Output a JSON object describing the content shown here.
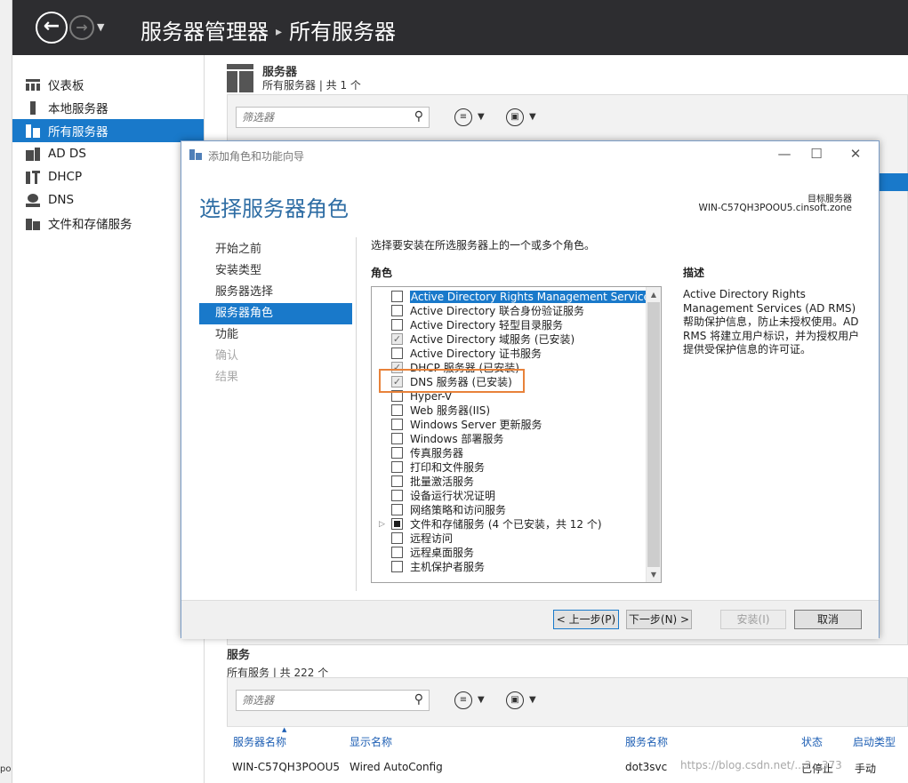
{
  "app": {
    "title": "服务器管理器",
    "breadcrumb_sep": "▸",
    "breadcrumb_current": "所有服务器"
  },
  "sidebar": {
    "items": [
      {
        "label": "仪表板",
        "icon": "dashboard-icon"
      },
      {
        "label": "本地服务器",
        "icon": "local-server-icon"
      },
      {
        "label": "所有服务器",
        "icon": "all-servers-icon",
        "active": true
      },
      {
        "label": "AD DS",
        "icon": "ad-ds-icon"
      },
      {
        "label": "DHCP",
        "icon": "dhcp-icon"
      },
      {
        "label": "DNS",
        "icon": "dns-icon"
      },
      {
        "label": "文件和存储服务",
        "icon": "file-storage-icon"
      }
    ]
  },
  "servers_section": {
    "title": "服务器",
    "subtitle": "所有服务器 | 共 1 个",
    "filter_placeholder": "筛选器"
  },
  "services_section": {
    "title": "服务",
    "subtitle": "所有服务 | 共 222 个",
    "filter_placeholder": "筛选器",
    "columns": [
      "服务器名称",
      "显示名称",
      "服务名称",
      "状态",
      "启动类型"
    ],
    "rows": [
      {
        "server": "WIN-C57QH3POOU5",
        "display": "Wired AutoConfig",
        "service": "dot3svc",
        "status": "已停止",
        "startup": "手动"
      }
    ]
  },
  "dialog": {
    "title": "添加角色和功能向导",
    "heading": "选择服务器角色",
    "target_label": "目标服务器",
    "target_value": "WIN-C57QH3POOU5.cinsoft.zone",
    "steps": [
      {
        "label": "开始之前",
        "state": "normal"
      },
      {
        "label": "安装类型",
        "state": "normal"
      },
      {
        "label": "服务器选择",
        "state": "normal"
      },
      {
        "label": "服务器角色",
        "state": "active"
      },
      {
        "label": "功能",
        "state": "normal"
      },
      {
        "label": "确认",
        "state": "disabled"
      },
      {
        "label": "结果",
        "state": "disabled"
      }
    ],
    "instruction": "选择要安装在所选服务器上的一个或多个角色。",
    "roles_label": "角色",
    "description_label": "描述",
    "description": "Active Directory Rights Management Services (AD RMS) 帮助保护信息，防止未授权使用。AD RMS 将建立用户标识，并为授权用户提供受保护信息的许可证。",
    "roles": [
      {
        "label": "Active Directory Rights Management Services",
        "state": "unchecked",
        "selected": true
      },
      {
        "label": "Active Directory 联合身份验证服务",
        "state": "unchecked"
      },
      {
        "label": "Active Directory 轻型目录服务",
        "state": "unchecked"
      },
      {
        "label": "Active Directory 域服务 (已安装)",
        "state": "checked"
      },
      {
        "label": "Active Directory 证书服务",
        "state": "unchecked"
      },
      {
        "label": "DHCP 服务器 (已安装)",
        "state": "checked"
      },
      {
        "label": "DNS 服务器 (已安装)",
        "state": "checked"
      },
      {
        "label": "Hyper-V",
        "state": "unchecked"
      },
      {
        "label": "Web 服务器(IIS)",
        "state": "unchecked"
      },
      {
        "label": "Windows Server 更新服务",
        "state": "unchecked"
      },
      {
        "label": "Windows 部署服务",
        "state": "unchecked"
      },
      {
        "label": "传真服务器",
        "state": "unchecked"
      },
      {
        "label": "打印和文件服务",
        "state": "unchecked"
      },
      {
        "label": "批量激活服务",
        "state": "unchecked"
      },
      {
        "label": "设备运行状况证明",
        "state": "unchecked"
      },
      {
        "label": "网络策略和访问服务",
        "state": "unchecked"
      },
      {
        "label": "文件和存储服务 (4 个已安装，共 12 个)",
        "state": "partial",
        "expandable": true
      },
      {
        "label": "远程访问",
        "state": "unchecked"
      },
      {
        "label": "远程桌面服务",
        "state": "unchecked"
      },
      {
        "label": "主机保护者服务",
        "state": "unchecked"
      }
    ],
    "buttons": {
      "prev": "< 上一步(P)",
      "next": "下一步(N) >",
      "install": "安装(I)",
      "cancel": "取消"
    }
  },
  "watermark": "https://blog.csdn.net/...2...373",
  "edge_text": "po",
  "colors": {
    "titlebar": "#2d2d30",
    "accent": "#1979ca",
    "heading": "#2e6da4",
    "highlight_box": "#e8823a"
  }
}
